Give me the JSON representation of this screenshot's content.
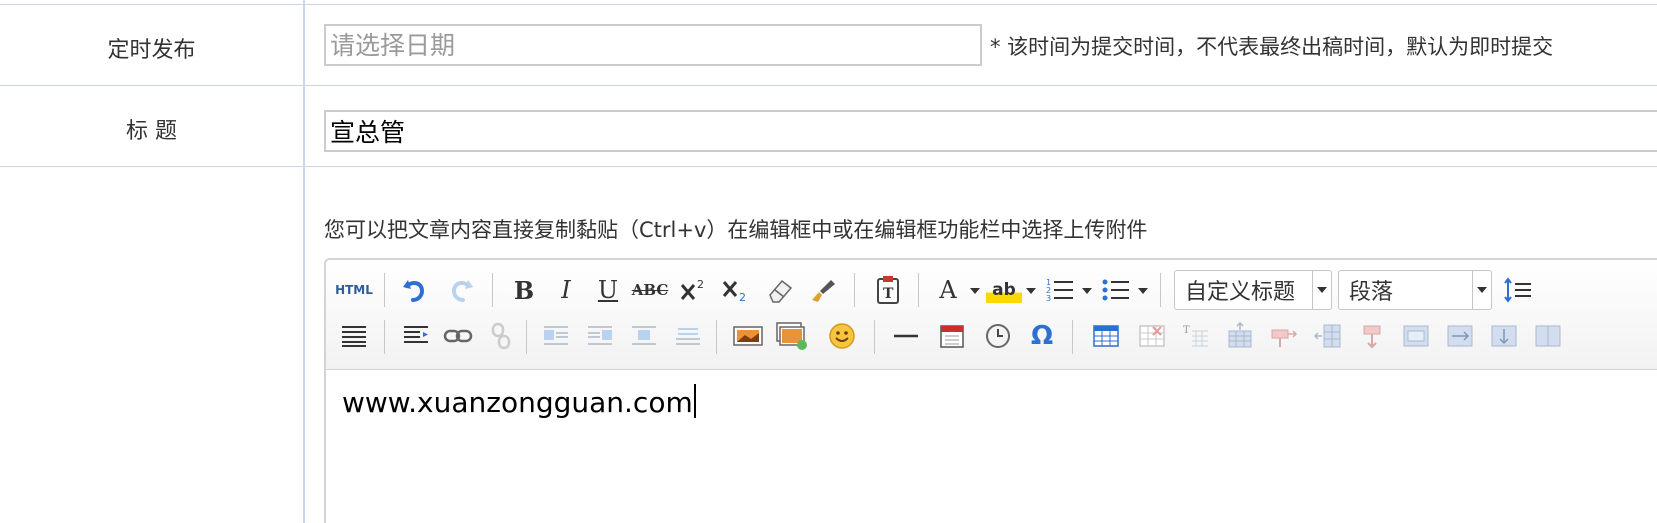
{
  "schedule": {
    "label": "定时发布",
    "date_placeholder": "请选择日期",
    "hint": "* 该时间为提交时间，不代表最终出稿时间，默认为即时提交"
  },
  "title_row": {
    "label": "标 题",
    "value": "宣总管"
  },
  "content_row": {
    "tip": "您可以把文章内容直接复制黏贴（Ctrl+v）在编辑框中或在编辑框功能栏中选择上传附件",
    "editor_text": "www.xuanzongguan.com"
  },
  "toolbar": {
    "html_label": "HTML",
    "bold_label": "B",
    "italic_label": "I",
    "underline_label": "U",
    "strike_label": "ABC",
    "font_color_label": "A",
    "highlight_label": "ab",
    "omega_label": "Ω",
    "custom_heading": "自定义标题",
    "paragraph": "段落"
  },
  "colors": {
    "border": "#c9d5ea",
    "accent_blue": "#2d6fd2",
    "text": "#333333"
  }
}
